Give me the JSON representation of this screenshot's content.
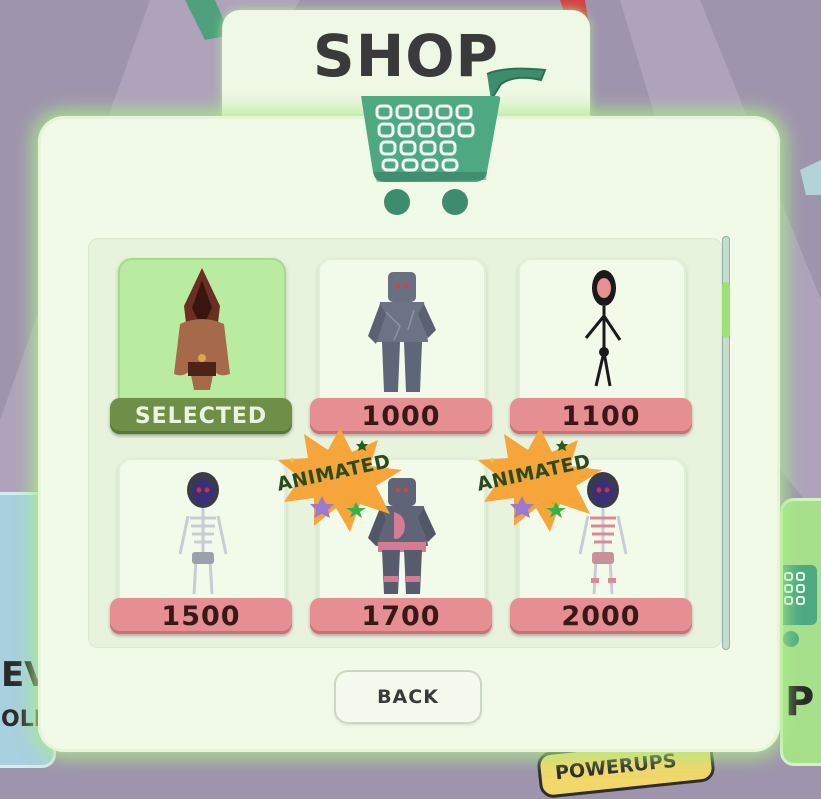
{
  "header": {
    "title": "SHOP"
  },
  "items": [
    {
      "label": "SELECTED",
      "selected": true,
      "character": "hooded-wanderer"
    },
    {
      "label": "1000",
      "selected": false,
      "character": "stone-golem"
    },
    {
      "label": "1100",
      "selected": false,
      "character": "stick-figure"
    },
    {
      "label": "1500",
      "selected": false,
      "character": "skeleton"
    },
    {
      "label": "1700",
      "selected": false,
      "character": "stone-golem-pink",
      "badge": "ANIMATED"
    },
    {
      "label": "2000",
      "selected": false,
      "character": "skeleton-pink",
      "badge": "ANIMATED"
    }
  ],
  "footer": {
    "back_label": "BACK"
  },
  "background": {
    "left_card_text": [
      "EV",
      "OLL"
    ],
    "right_card_text": "P",
    "bottom_card_text": [
      "POWERUPS"
    ]
  },
  "colors": {
    "panel": "#f0fae6",
    "price_tag": "#e58f92",
    "selected_tag": "#6f8f48",
    "selected_card": "#b9eca0",
    "badge": "#f5a53a",
    "cart": "#4ea882",
    "background": "#9f94ad"
  }
}
